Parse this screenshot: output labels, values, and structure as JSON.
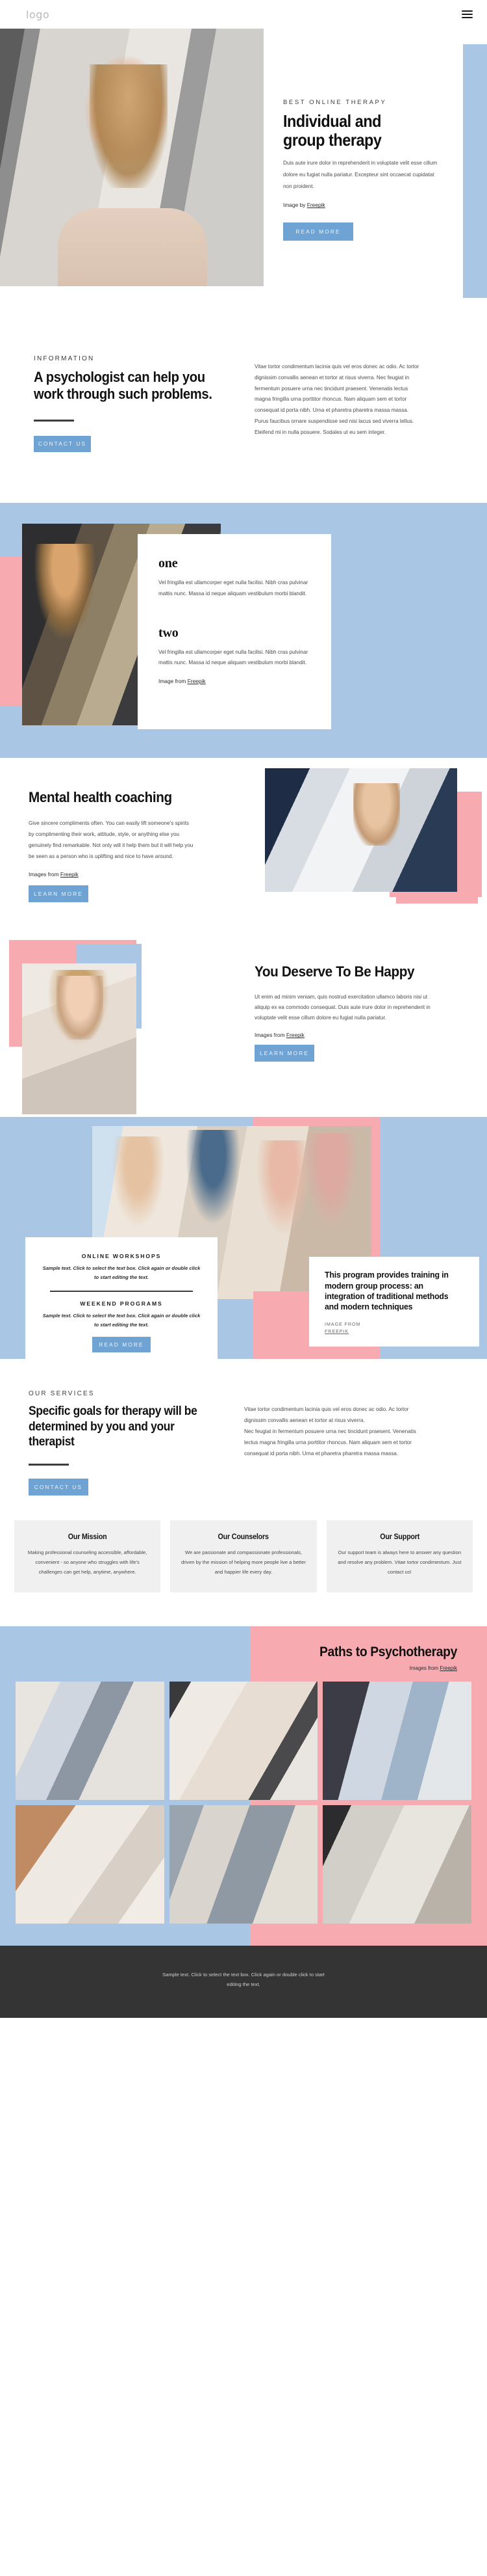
{
  "header": {
    "logo": "logo",
    "menu_icon": "hamburger-menu-icon"
  },
  "hero": {
    "eyebrow": "BEST ONLINE THERAPY",
    "title_line1": "Individual and",
    "title_line2": "group therapy",
    "body": "Duis aute irure dolor in reprehenderit in voluptate velit esse cillum dolore eu fugiat nulla pariatur. Excepteur sint occaecat cupidatat non proident.",
    "credit_prefix": "Image by ",
    "credit_link": "Freepik",
    "cta": "READ MORE"
  },
  "information": {
    "eyebrow": "INFORMATION",
    "title": "A psychologist can help you work through such problems.",
    "cta": "CONTACT US",
    "body": "Vitae tortor condimentum lacinia quis vel eros donec ac odio. Ac tortor dignissim convallis aenean et tortor at risus viverra. Nec feugiat in fermentum posuere urna nec tincidunt praesent. Venenatis lectus magna fringilla urna porttitor rhoncus. Nam aliquam sem et tortor consequat id porta nibh. Urna et pharetra pharetra massa massa. Purus faucibus ornare suspendisse sed nisi lacus sed viverra tellus. Eleifend mi in nulla posuere. Sodales ut eu sem integer."
  },
  "two_block": {
    "item_one_label": "one",
    "item_one_body": "Vel fringilla est ullamcorper eget nulla facilisi. Nibh cras pulvinar mattis nunc. Massa id neque aliquam vestibulum morbi blandit.",
    "item_two_label": "two",
    "item_two_body": "Vel fringilla est ullamcorper eget nulla facilisi. Nibh cras pulvinar mattis nunc. Massa id neque aliquam vestibulum morbi blandit.",
    "credit_prefix": "Image from ",
    "credit_link": "Freepik"
  },
  "coaching": {
    "title": "Mental health coaching",
    "body": "Give sincere compliments often. You can easily lift someone’s spirits by complimenting their work, attitude, style, or anything else you genuinely find remarkable. Not only will it help them but it will help you be seen as a person who is uplifting and nice to have around.",
    "credit_prefix": "Images from ",
    "credit_link": "Freepik",
    "cta": "LEARN MORE"
  },
  "happy": {
    "title": "You Deserve To Be Happy",
    "body": "Ut enim ad minim veniam, quis nostrud exercitation ullamco laboris nisi ut aliquip ex ea commodo consequat. Duis aute irure dolor in reprehenderit in voluptate velit esse cillum dolore eu fugiat nulla pariatur.",
    "credit_prefix": "Images from ",
    "credit_link": "Freepik",
    "cta": "LEARN MORE"
  },
  "workshops": {
    "item1_title": "ONLINE WORKSHOPS",
    "item1_body": "Sample text. Click to select the text box. Click again or double click to start editing the text.",
    "item2_title": "WEEKEND PROGRAMS",
    "item2_body": "Sample text. Click to select the text box. Click again or double click to start editing the text.",
    "cta": "READ MORE",
    "program_title": "This program provides training in modern group process: an integration of traditional methods and modern techniques",
    "program_credit_prefix": "IMAGE FROM ",
    "program_credit_link": "FREEPIK"
  },
  "services": {
    "eyebrow": "OUR SERVICES",
    "title": "Specific goals for therapy will be determined by you and your therapist",
    "cta": "CONTACT US",
    "body_p1": "Vitae tortor condimentum lacinia quis vel eros donec ac odio. Ac tortor dignissim convallis aenean et tortor at risus viverra.",
    "body_p2": "Nec feugiat in fermentum posuere urna nec tincidunt praesent. Venenatis lectus magna fringilla urna porttitor rhoncus. Nam aliquam sem et tortor consequat id porta nibh. Urna et pharetra pharetra massa massa.",
    "cards": [
      {
        "title": "Our Mission",
        "body": "Making professional counseling accessible, affordable, convenient - so anyone who struggles with life’s challenges can get help, anytime, anywhere."
      },
      {
        "title": "Our Counselors",
        "body": "We are passionate and compassionate professionals, driven by the mission of helping more people live a better and happier life every day."
      },
      {
        "title": "Our Support",
        "body": "Our support team is always here to answer any question and resolve any problem. Vitae tortor condimentum. Just contact us!"
      }
    ]
  },
  "paths": {
    "title": "Paths to Psychotherapy",
    "credit_prefix": "Images from ",
    "credit_link": "Freepik",
    "gallery": [
      "couple-consoling-photo",
      "smiling-therapist-with-tablet-photo",
      "therapist-taking-notes-photo",
      "man-comforting-woman-photo",
      "group-holding-hands-photo",
      "hand-on-shoulder-photo"
    ]
  },
  "footer": {
    "text": "Sample text. Click to select the text box. Click again or double click to start editing the text."
  },
  "colors": {
    "accent_blue": "#6fa3d4",
    "band_blue": "#a9c7e5",
    "band_pink": "#f7aab0",
    "footer_dark": "#343434",
    "card_gray": "#f0f0f0"
  }
}
